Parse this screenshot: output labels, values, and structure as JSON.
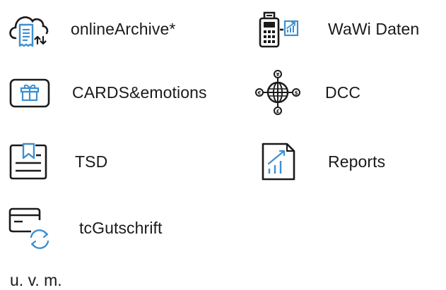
{
  "features": [
    {
      "id": "archive",
      "label": "onlineArchive*",
      "icon": "cloud-receipt-icon"
    },
    {
      "id": "wawi",
      "label": "WaWi Daten",
      "icon": "pos-terminal-chart-icon"
    },
    {
      "id": "cards",
      "label": "CARDS&emotions",
      "icon": "gift-card-icon"
    },
    {
      "id": "dcc",
      "label": "DCC",
      "icon": "globe-currency-icon"
    },
    {
      "id": "tsd",
      "label": "TSD",
      "icon": "bookmark-document-icon"
    },
    {
      "id": "reports",
      "label": "Reports",
      "icon": "report-chart-icon"
    },
    {
      "id": "gut",
      "label": "tcGutschrift",
      "icon": "card-refresh-icon"
    }
  ],
  "more_text": "u. v. m.",
  "colors": {
    "icon_dark": "#1a1a1a",
    "icon_accent": "#3d8fd1"
  },
  "currency_symbols": [
    "¥",
    "€",
    "$",
    "£"
  ]
}
